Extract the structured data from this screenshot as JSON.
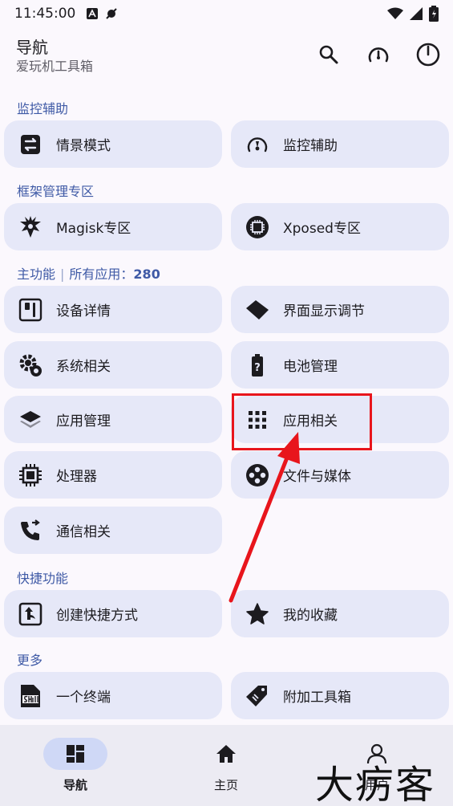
{
  "status": {
    "time": "11:45:00"
  },
  "header": {
    "title": "导航",
    "subtitle": "爱玩机工具箱"
  },
  "actions": {
    "search_icon": "search-icon",
    "speed_icon": "speedometer-icon",
    "power_icon": "power-icon"
  },
  "sections": {
    "monitor": "监控辅助",
    "framework": "框架管理专区",
    "main_label": "主功能",
    "main_apps_label": "所有应用：",
    "main_apps_count": "280",
    "shortcuts": "快捷功能",
    "more": "更多"
  },
  "cards": {
    "scene_mode": "情景模式",
    "monitor_assist": "监控辅助",
    "magisk": "Magisk专区",
    "xposed": "Xposed专区",
    "device_info": "设备详情",
    "display_adjust": "界面显示调节",
    "system": "系统相关",
    "battery": "电池管理",
    "app_manage": "应用管理",
    "app_related": "应用相关",
    "processor": "处理器",
    "files_media": "文件与媒体",
    "communication": "通信相关",
    "create_shortcut": "创建快捷方式",
    "favorites": "我的收藏",
    "terminal": "一个终端",
    "extra_tools": "附加工具箱"
  },
  "nav": {
    "navigation": "导航",
    "home": "主页",
    "user": "用户"
  },
  "watermark": "大疠客",
  "colors": {
    "accent": "#3f5aa6",
    "card": "#e6e8f8",
    "highlight": "#e8151c"
  }
}
